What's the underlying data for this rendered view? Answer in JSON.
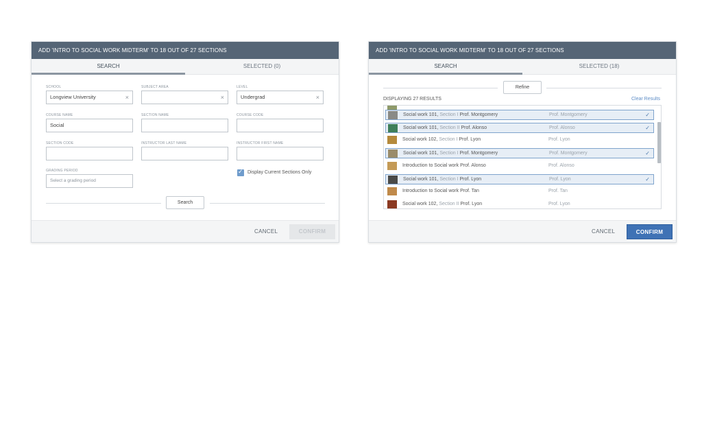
{
  "dialog1": {
    "title": "ADD 'INTRO TO SOCIAL WORK MIDTERM' TO 18 OUT OF 27 SECTIONS",
    "tab_search": "SEARCH",
    "tab_selected": "SELECTED (0)",
    "school_label": "SCHOOL",
    "school_value": "Longview University",
    "subject_label": "SUBJECT AREA",
    "subject_value": "",
    "level_label": "LEVEL",
    "level_value": "Undergrad",
    "course_name_label": "COURSE NAME",
    "course_name_value": "Social",
    "section_name_label": "SECTION NAME",
    "course_code_label": "COURSE CODE",
    "section_code_label": "SECTION CODE",
    "instr_last_label": "INSTRUCTOR LAST NAME",
    "instr_first_label": "INSTRUCTOR FIRST NAME",
    "grading_label": "GRADING PERIOD",
    "grading_placeholder": "Select a grading period",
    "display_current": "Display Current Sections Only",
    "search_button": "Search",
    "cancel": "CANCEL",
    "confirm": "CONFIRM"
  },
  "dialog2": {
    "title": "ADD 'INTRO TO SOCIAL WORK MIDTERM' TO 18 OUT OF 27 SECTIONS",
    "tab_search": "SEARCH",
    "tab_selected": "SELECTED (18)",
    "refine_button": "Refine",
    "results_count": "DISPLAYING 27 RESULTS",
    "clear_results": "Clear Results",
    "cancel": "CANCEL",
    "confirm": "CONFIRM",
    "rows": [
      {
        "course": "Social work 101,",
        "section": "Section I",
        "prof_inline": "Prof. Montgomery",
        "prof": "Prof. Montgomery",
        "selected": true,
        "check": "✓",
        "thumb": "#8a8a86"
      },
      {
        "course": "Social work 101,",
        "section": "Section II",
        "prof_inline": "Prof. Alonso",
        "prof": "Prof. Alonso",
        "selected": true,
        "check": "✓",
        "thumb": "#3f7f5a"
      },
      {
        "course": "Social work 102,",
        "section": "Section I",
        "prof_inline": "Prof. Lyon",
        "prof": "Prof. Lyon",
        "selected": false,
        "check": "",
        "thumb": "#b58a3c"
      },
      {
        "course": "Social work 101,",
        "section": "Section I",
        "prof_inline": "Prof. Montgomery",
        "prof": "Prof. Montgomery",
        "selected": true,
        "check": "✓",
        "thumb": "#9a8c6a"
      },
      {
        "course": "Introduction to Social work",
        "section": "",
        "prof_inline": "Prof. Alonso",
        "prof": "Prof. Alonso",
        "selected": false,
        "check": "",
        "thumb": "#c49a56"
      },
      {
        "course": "Social work 101,",
        "section": "Section I",
        "prof_inline": "Prof. Lyon",
        "prof": "Prof. Lyon",
        "selected": true,
        "check": "✓",
        "thumb": "#4a4a48"
      },
      {
        "course": "Introduction to Social work",
        "section": "",
        "prof_inline": "Prof. Tan",
        "prof": "Prof. Tan",
        "selected": false,
        "check": "",
        "thumb": "#c08a4a"
      },
      {
        "course": "Social work 102,",
        "section": "Section II",
        "prof_inline": "Prof. Lyon",
        "prof": "Prof. Lyon",
        "selected": false,
        "check": "",
        "thumb": "#8b3a22"
      }
    ]
  }
}
